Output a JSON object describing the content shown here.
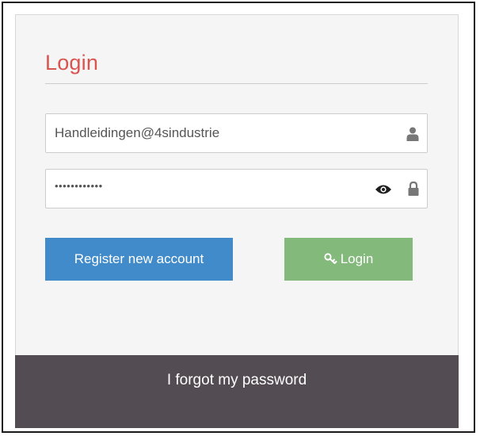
{
  "login_panel": {
    "title": "Login",
    "username": {
      "value": "Handleidingen@4sindustrie",
      "icon": "user-icon"
    },
    "password": {
      "masked_value": "••••••••••••",
      "reveal_icon": "eye-icon",
      "lock_icon": "lock-icon"
    },
    "buttons": {
      "register_label": "Register new account",
      "login_label": "Login",
      "login_icon": "key-icon"
    },
    "forgot_password_label": "I forgot my password"
  },
  "colors": {
    "title": "#d9534f",
    "register_button": "#428bca",
    "login_button": "#83b97a",
    "footer": "#534c53",
    "panel_background": "#f5f5f5"
  }
}
